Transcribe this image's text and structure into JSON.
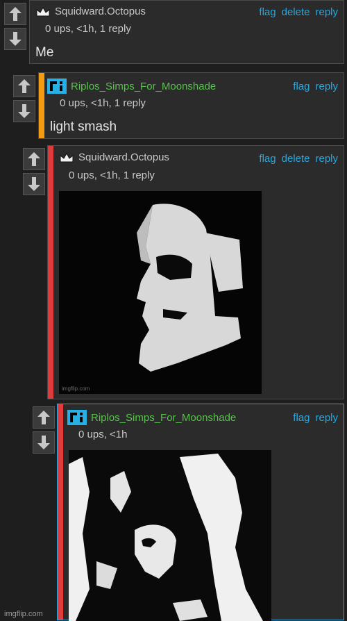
{
  "comments": [
    {
      "username": "Squidward.Octopus",
      "stats": "0 ups, <1h, 1 reply",
      "text": "Me",
      "actions": [
        "flag",
        "delete",
        "reply"
      ]
    },
    {
      "username": "Riplos_Simps_For_Moonshade",
      "stats": "0 ups, <1h, 1 reply",
      "text": "light smash",
      "actions": [
        "flag",
        "reply"
      ]
    },
    {
      "username": "Squidward.Octopus",
      "stats": "0 ups, <1h, 1 reply",
      "image_watermark": "imgflip.com",
      "actions": [
        "flag",
        "delete",
        "reply"
      ]
    },
    {
      "username": "Riplos_Simps_For_Moonshade",
      "stats": "0 ups, <1h",
      "actions": [
        "flag",
        "reply"
      ]
    }
  ],
  "footer": "imgflip.com",
  "colors": {
    "link": "#29a8df",
    "green_user": "#55c34a",
    "orange_bar": "#f39c12",
    "red_bar": "#e03a3a",
    "blue_bar": "#29a8df"
  },
  "icons": {
    "upvote": "up-arrow-icon",
    "downvote": "down-arrow-icon",
    "crown": "crown-icon",
    "pixel_avatar": "pixel-avatar-icon"
  }
}
